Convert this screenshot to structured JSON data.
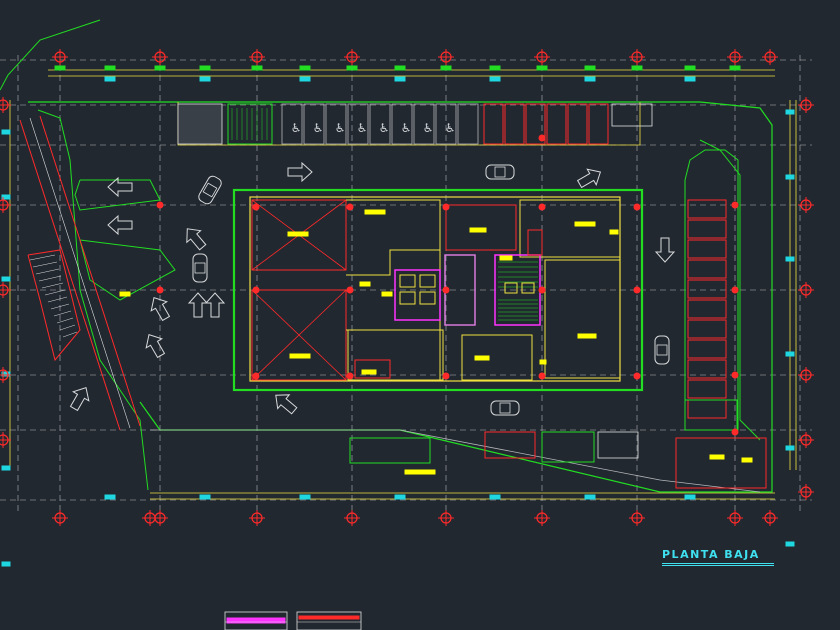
{
  "drawing": {
    "title": "PLANTA BAJA",
    "colors": {
      "background": "#212830",
      "grid": "#b4b6ba",
      "axis_marker": "#ff2a2a",
      "dimension": "#f0e040",
      "building_outline": "#22dd22",
      "interior_wall": "#f0e040",
      "stair_core": "#ff33ff",
      "parking_stall": "#ff2a2a",
      "annotation": "#ffff00",
      "title": "#3fe0f0",
      "hatch": "#e0e0e0",
      "tag_cyan": "#1fd7e0",
      "tag_green": "#22dd22"
    },
    "icons": [
      "axis-marker-icon",
      "car-icon",
      "arrow-icon",
      "accessible-parking-icon",
      "stair-icon",
      "elevator-icon"
    ]
  }
}
